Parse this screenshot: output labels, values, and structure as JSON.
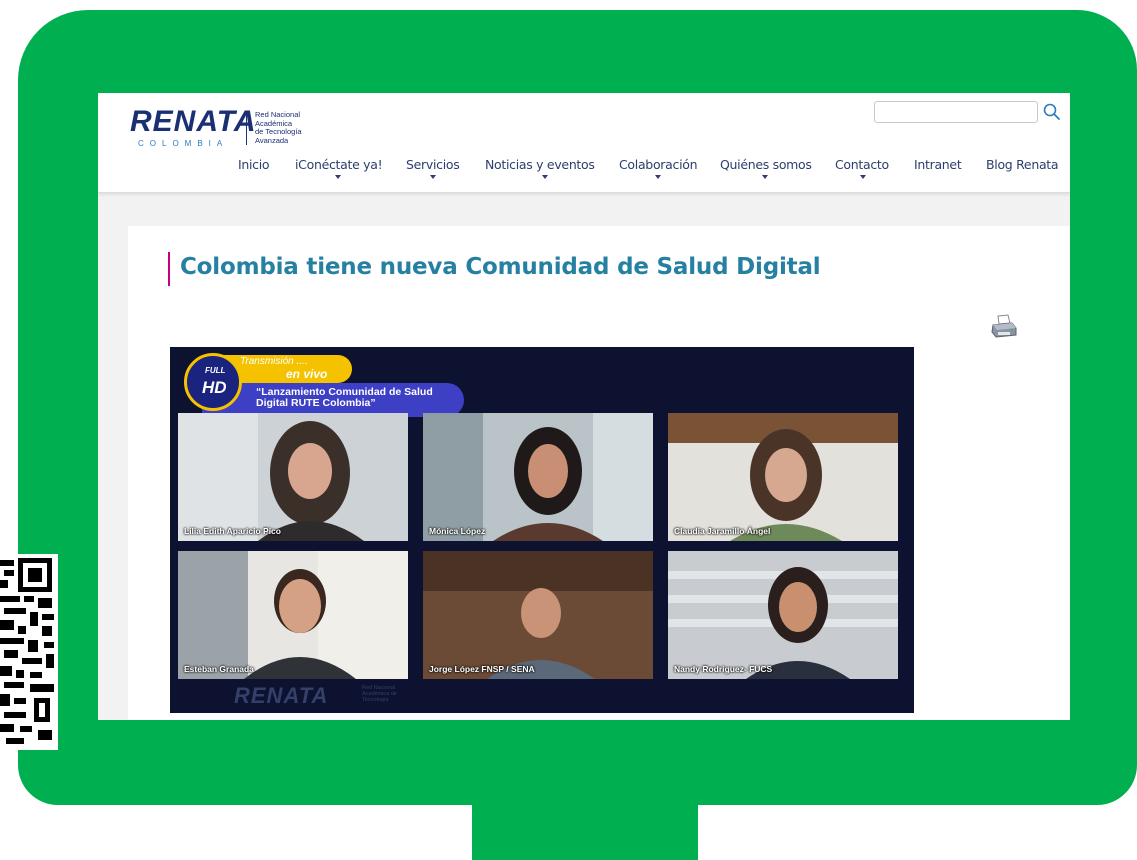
{
  "site": {
    "logo_text": "RENATA",
    "logo_subtext": "COLOMBIA",
    "logo_tagline": [
      "Red Nacional",
      "Académica",
      "de Tecnología",
      "Avanzada"
    ],
    "search_placeholder": "",
    "search_icon": "search-icon"
  },
  "nav": {
    "items": [
      {
        "label": "Inicio",
        "has_dropdown": false
      },
      {
        "label": "iConéctate ya!",
        "has_dropdown": true
      },
      {
        "label": "Servicios",
        "has_dropdown": true
      },
      {
        "label": "Noticias y eventos",
        "has_dropdown": true
      },
      {
        "label": "Colaboración",
        "has_dropdown": true
      },
      {
        "label": "Quiénes somos",
        "has_dropdown": true
      },
      {
        "label": "Contacto",
        "has_dropdown": true
      },
      {
        "label": "Intranet",
        "has_dropdown": false
      },
      {
        "label": "Blog Renata",
        "has_dropdown": false
      }
    ]
  },
  "article": {
    "title": "Colombia tiene nueva Comunidad de Salud Digital",
    "print_icon": "printer-icon"
  },
  "video": {
    "badge_small": "FULL",
    "badge_big": "HD",
    "live_line1": "Transmisión ....",
    "live_line2": "en vivo",
    "event_title": "“Lanzamiento Comunidad de Salud Digital  RUTE Colombia”",
    "logo_text": "RENATA",
    "logo_tagline": "Red Nacional Académica de Tecnología",
    "participants": [
      {
        "name": "Lilia Edith Aparicio Pico"
      },
      {
        "name": "Mónica López"
      },
      {
        "name": "Claudia Jaramillo Ángel"
      },
      {
        "name": "Esteban Granada"
      },
      {
        "name": "Jorge López FNSP / SENA"
      },
      {
        "name": "Nandy Rodriguez- FUCS"
      }
    ]
  },
  "colors": {
    "frame": "#00b050",
    "nav_text": "#2c3e6b",
    "title": "#2580a2",
    "title_accent": "#c4007a",
    "video_bg": "#0c1230"
  }
}
